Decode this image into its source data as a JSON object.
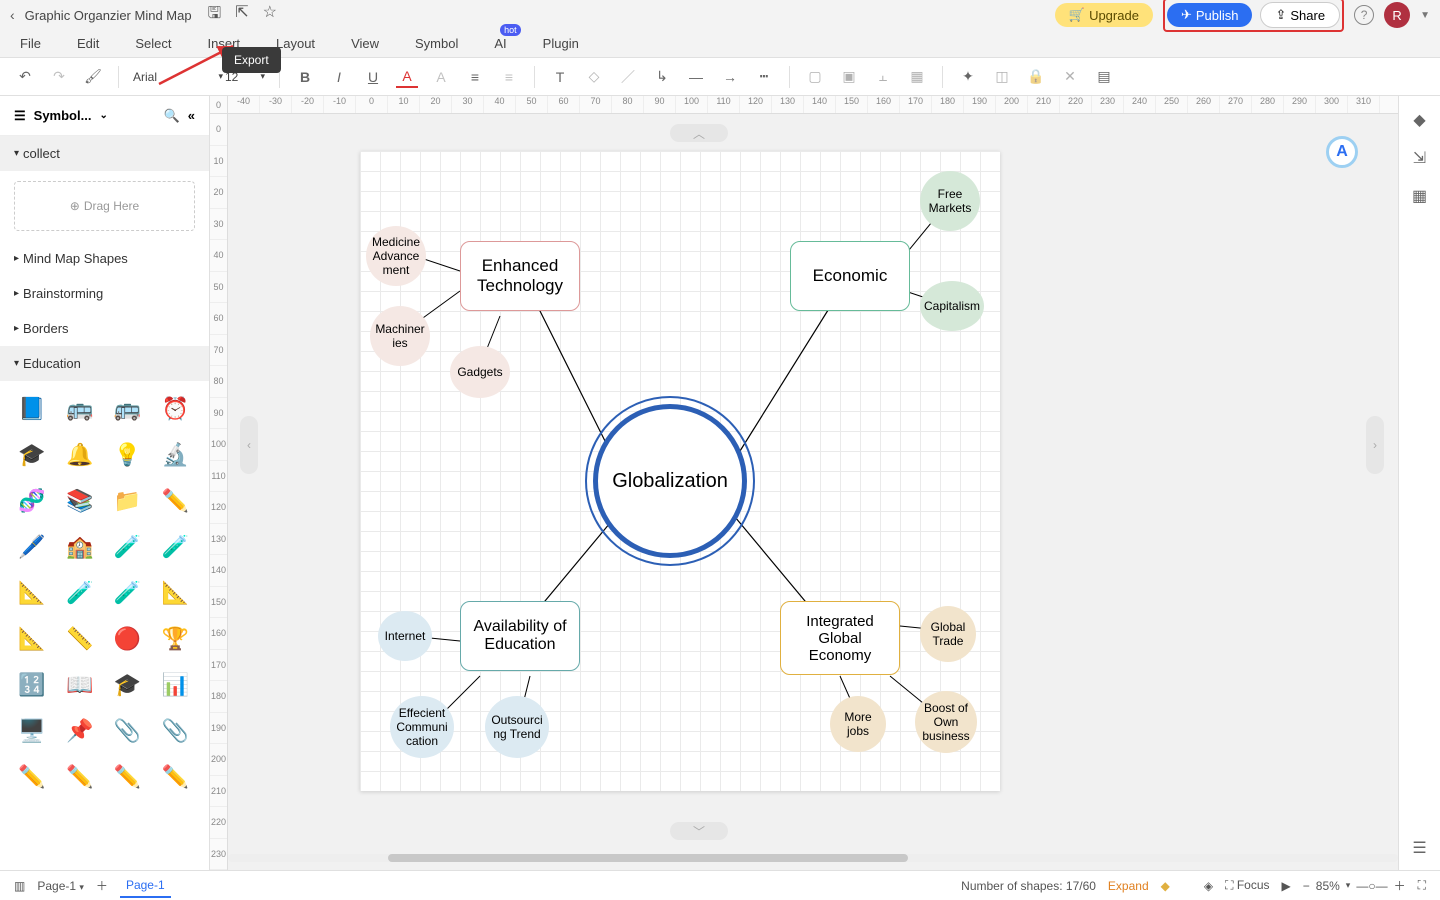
{
  "titlebar": {
    "doc_title": "Graphic Organzier Mind Map",
    "upgrade": "Upgrade",
    "publish": "Publish",
    "share": "Share",
    "avatar": "R"
  },
  "menu": [
    "File",
    "Edit",
    "Select",
    "Insert",
    "Layout",
    "View",
    "Symbol",
    "AI",
    "Plugin"
  ],
  "tooltip": {
    "export": "Export"
  },
  "toolbar": {
    "font_name": "Arial",
    "font_size": "12"
  },
  "sidebar": {
    "title": "Symbol...",
    "collect": "collect",
    "drag": "Drag Here",
    "sections": [
      "Mind Map Shapes",
      "Brainstorming",
      "Borders",
      "Education"
    ],
    "edu_icons": [
      "📘",
      "🚌",
      "🚌",
      "⏰",
      "🎓",
      "🔔",
      "💡",
      "🔬",
      "🧬",
      "📚",
      "📁",
      "✏️",
      "🖊️",
      "🏫",
      "🧪",
      "🧪",
      "📐",
      "🧪",
      "🧪",
      "📐",
      "📐",
      "📏",
      "🔴",
      "🏆",
      "🔢",
      "📖",
      "🎓",
      "📊",
      "🖥️",
      "📌",
      "📎",
      "📎",
      "✏️",
      "✏️",
      "✏️",
      "✏️"
    ]
  },
  "ruler_h": [
    "-40",
    "-30",
    "-20",
    "-10",
    "0",
    "10",
    "20",
    "30",
    "40",
    "50",
    "60",
    "70",
    "80",
    "90",
    "100",
    "110",
    "120",
    "130",
    "140",
    "150",
    "160",
    "170",
    "180",
    "190",
    "200",
    "210",
    "220",
    "230",
    "240",
    "250",
    "260",
    "270",
    "280",
    "290",
    "300",
    "310"
  ],
  "ruler_v": [
    "0",
    "10",
    "20",
    "30",
    "40",
    "50",
    "60",
    "70",
    "80",
    "90",
    "100",
    "110",
    "120",
    "130",
    "140",
    "150",
    "160",
    "170",
    "180",
    "190",
    "200",
    "210",
    "220",
    "230"
  ],
  "mindmap": {
    "center": "Globalization",
    "tech": {
      "title": "Enhanced Technology",
      "leaves": [
        "Medicine Advance ment",
        "Machiner ies",
        "Gadgets"
      ]
    },
    "econ": {
      "title": "Economic",
      "leaves": [
        "Free Markets",
        "Capitalism"
      ]
    },
    "edu": {
      "title": "Availability of Education",
      "leaves": [
        "Internet",
        "Effecient Communi cation",
        "Outsourci ng Trend"
      ]
    },
    "glob": {
      "title": "Integrated Global Economy",
      "leaves": [
        "Global Trade",
        "More jobs",
        "Boost of Own business"
      ]
    }
  },
  "statusbar": {
    "page_sel": "Page-1",
    "page_tab": "Page-1",
    "shapes": "Number of shapes: 17/60",
    "expand": "Expand",
    "focus": "Focus",
    "zoom": "85%"
  }
}
